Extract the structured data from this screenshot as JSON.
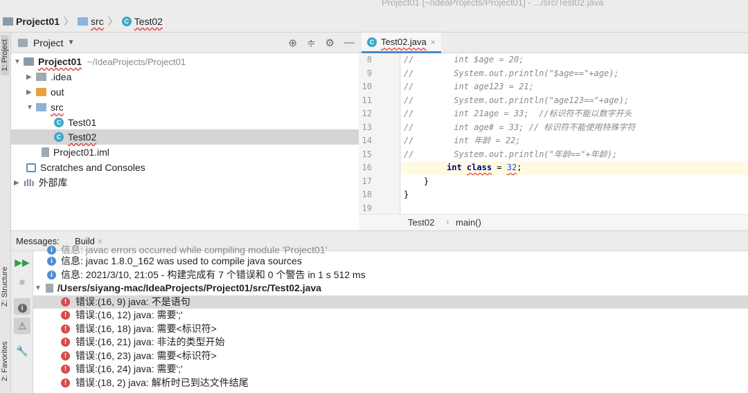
{
  "window_title": "Project01 [~/IdeaProjects/Project01] - .../src/Test02.java",
  "breadcrumbs": [
    "Project01",
    "src",
    "Test02"
  ],
  "side_tabs": {
    "project": "1: Project",
    "structure": "Z: Structure",
    "favorites": "2: Favorites"
  },
  "project_panel": {
    "title": "Project",
    "tree": [
      {
        "label": "Project01",
        "path": "~/IdeaProjects/Project01"
      },
      {
        "label": ".idea"
      },
      {
        "label": "out"
      },
      {
        "label": "src"
      },
      {
        "label": "Test01"
      },
      {
        "label": "Test02"
      },
      {
        "label": "Project01.iml"
      },
      {
        "label": "Scratches and Consoles"
      },
      {
        "label": "外部库"
      }
    ]
  },
  "editor": {
    "tab": "Test02.java",
    "lines": [
      {
        "n": "8",
        "text": "//        int $age = 20;"
      },
      {
        "n": "9",
        "text": "//        System.out.println(\"$age==\"+age);"
      },
      {
        "n": "10",
        "text": "//        int age123 = 21;"
      },
      {
        "n": "11",
        "text": "//        System.out.println(\"age123==\"+age);"
      },
      {
        "n": "12",
        "text": "//        int 21age = 33;  //标识符不能以数字开头"
      },
      {
        "n": "13",
        "text": "//        int age# = 33; // 标识符不能使用特殊字符"
      },
      {
        "n": "14",
        "text": "//        int 年龄 = 22;"
      },
      {
        "n": "15",
        "text": "//        System.out.println(\"年龄==\"+年龄);"
      },
      {
        "n": "16",
        "kw1": "int",
        "kw2": "class",
        "eq": "=",
        "num": "32",
        "semi": ";"
      },
      {
        "n": "17",
        "text": "    }"
      },
      {
        "n": "18",
        "text": "}"
      },
      {
        "n": "19",
        "text": ""
      }
    ],
    "breadcrumb": [
      "Test02",
      "main()"
    ]
  },
  "messages": {
    "label": "Messages:",
    "tab": "Build",
    "partial": "信息: javac errors occurred while compiling module 'Project01'",
    "items": [
      {
        "type": "info",
        "text": "信息: javac 1.8.0_162 was used to compile java sources"
      },
      {
        "type": "info",
        "text": "信息: 2021/3/10, 21:05 - 构建完成有 7 个错误和 0 个警告 in 1 s 512 ms"
      },
      {
        "type": "file",
        "text": "/Users/siyang-mac/IdeaProjects/Project01/src/Test02.java"
      },
      {
        "type": "error",
        "text": "错误:(16, 9)  java: 不是语句"
      },
      {
        "type": "error",
        "text": "错误:(16, 12)  java: 需要';'"
      },
      {
        "type": "error",
        "text": "错误:(16, 18)  java: 需要<标识符>"
      },
      {
        "type": "error",
        "text": "错误:(16, 21)  java: 非法的类型开始"
      },
      {
        "type": "error",
        "text": "错误:(16, 23)  java: 需要<标识符>"
      },
      {
        "type": "error",
        "text": "错误:(16, 24)  java: 需要';'"
      },
      {
        "type": "error",
        "text": "错误:(18, 2)  java: 解析时已到达文件结尾"
      }
    ]
  }
}
